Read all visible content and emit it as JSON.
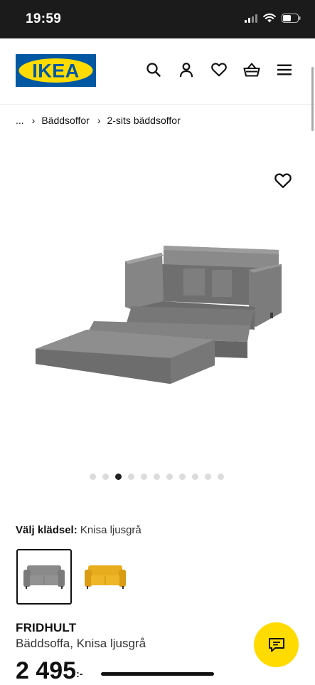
{
  "status_bar": {
    "time": "19:59"
  },
  "header": {
    "logo_text": "IKEA",
    "icons": [
      "search-icon",
      "user-icon",
      "heart-icon",
      "basket-icon",
      "menu-icon"
    ]
  },
  "breadcrumb": {
    "ellipsis": "...",
    "separator": "›",
    "items": [
      "Bäddsoffor",
      "2-sits bäddsoffor"
    ]
  },
  "gallery": {
    "image_count": 11,
    "active_index": 2
  },
  "fabric": {
    "label": "Välj klädsel:",
    "value": "Knisa ljusgrå",
    "options": [
      {
        "name": "Knisa ljusgrå",
        "color": "#7d7d7d",
        "selected": true
      },
      {
        "name": "gul",
        "color": "#e3a51c",
        "selected": false
      }
    ]
  },
  "product": {
    "name": "FRIDHULT",
    "description": "Bäddsoffa, Knisa ljusgrå",
    "price": "2 495",
    "price_suffix": ":-"
  },
  "colors": {
    "ikea_blue": "#0058a3",
    "ikea_yellow": "#ffdb00",
    "sofa_gray": "#7d7d7d"
  }
}
